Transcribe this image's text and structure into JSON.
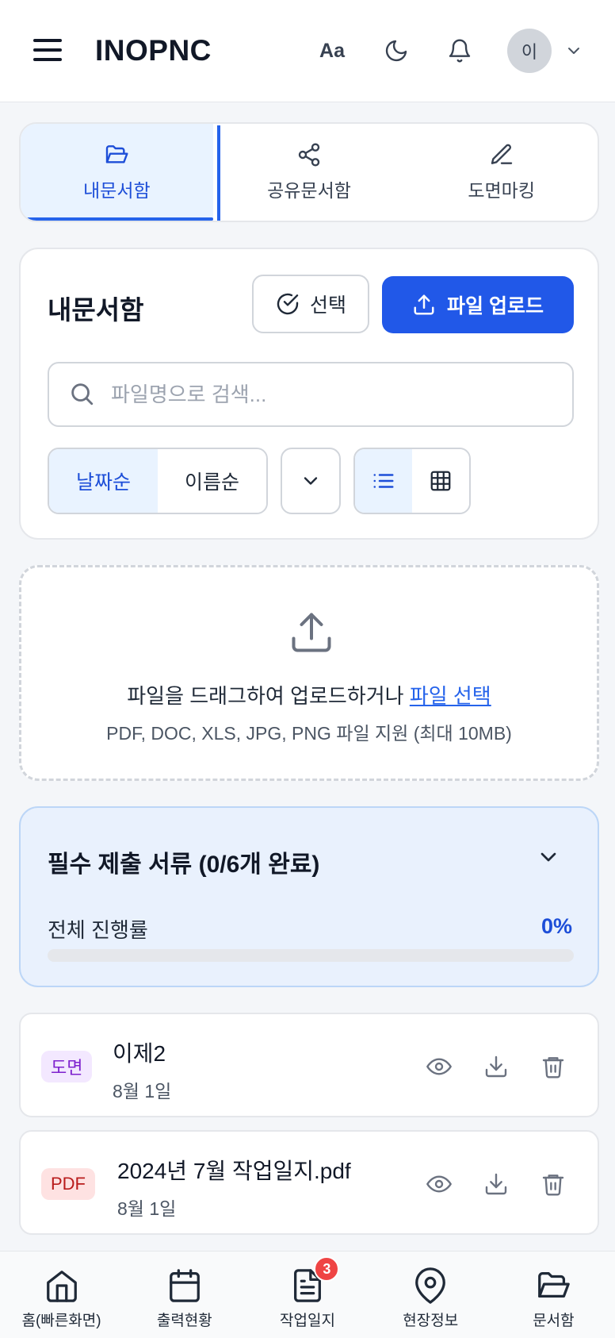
{
  "header": {
    "brand": "INOPNC",
    "font_size_label": "Aa",
    "avatar_initial": "이"
  },
  "tabs": [
    {
      "label": "내문서함",
      "icon": "folder-open-icon",
      "active": true
    },
    {
      "label": "공유문서함",
      "icon": "share-icon",
      "active": false
    },
    {
      "label": "도면마킹",
      "icon": "pencil-icon",
      "active": false
    }
  ],
  "main": {
    "title": "내문서함",
    "select_label": "선택",
    "upload_label": "파일 업로드",
    "search_placeholder": "파일명으로 검색...",
    "sort_options": [
      "날짜순",
      "이름순"
    ],
    "active_sort": "날짜순",
    "view_mode": "list"
  },
  "dropzone": {
    "text": "파일을 드래그하여 업로드하거나 ",
    "link": "파일 선택",
    "sub": "PDF, DOC, XLS, JPG, PNG 파일 지원 (최대 10MB)"
  },
  "required": {
    "title": "필수 제출 서류 (0/6개 완료)",
    "progress_label": "전체 진행률",
    "progress_text": "0%",
    "progress_value": 0
  },
  "files": [
    {
      "badge": "도면",
      "type": "drawing",
      "name": "이제2",
      "date": "8월 1일"
    },
    {
      "badge": "PDF",
      "type": "pdf",
      "name": "2024년 7월 작업일지.pdf",
      "date": "8월 1일"
    }
  ],
  "bottom_nav": [
    {
      "label": "홈(빠른화면)",
      "icon": "home-icon"
    },
    {
      "label": "출력현황",
      "icon": "calendar-icon"
    },
    {
      "label": "작업일지",
      "icon": "document-icon",
      "badge": "3"
    },
    {
      "label": "현장정보",
      "icon": "map-pin-icon"
    },
    {
      "label": "문서함",
      "icon": "folder-open-icon"
    }
  ],
  "colors": {
    "accent": "#2158e8",
    "active_tab_bg": "#e9f3ff",
    "required_bg": "#e9f1fd",
    "badge_red": "#ef4444"
  }
}
